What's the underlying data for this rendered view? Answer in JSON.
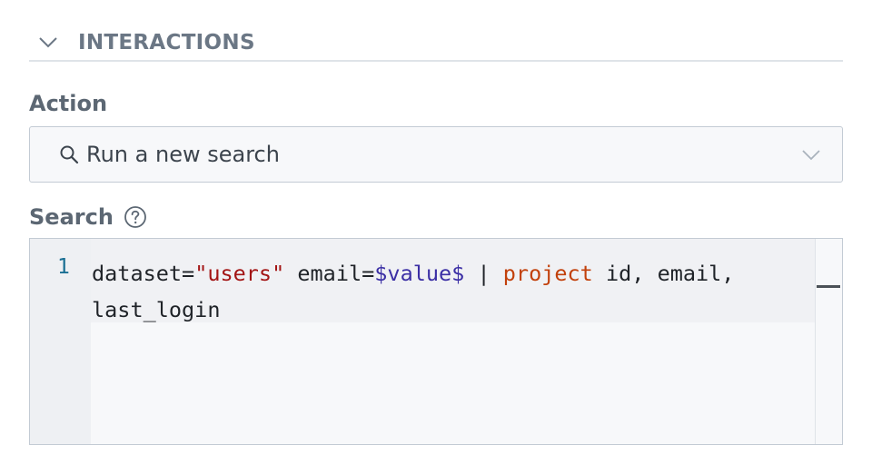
{
  "section": {
    "title": "INTERACTIONS",
    "icon": "chevron-down-icon"
  },
  "action": {
    "label": "Action",
    "selected": "Run a new search",
    "icon": "search-icon",
    "caret_icon": "chevron-down-icon"
  },
  "search": {
    "label": "Search",
    "help_icon": "question-circle-icon",
    "line_number": "1",
    "code": {
      "t1": "dataset=",
      "t2": "\"users\"",
      "t3": " email=",
      "t4": "$value$",
      "t5": " | ",
      "t6": "project",
      "t7": " id, email,",
      "t8": "last_login"
    }
  },
  "colors": {
    "string": "#a31515",
    "variable": "#3b2fa5",
    "keyword": "#c2410c",
    "line_number": "#1a6f93"
  }
}
